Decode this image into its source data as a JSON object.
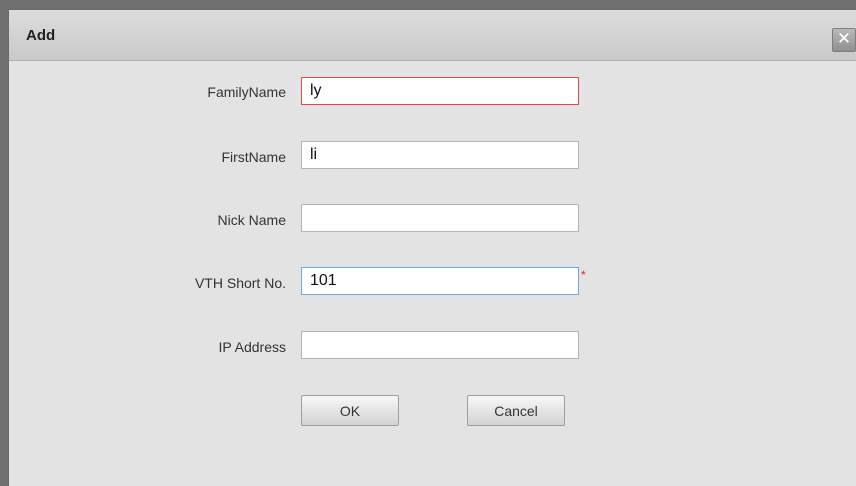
{
  "dialog": {
    "title": "Add",
    "close_glyph": "✕",
    "close_icon": "close-icon"
  },
  "form": {
    "family_name": {
      "label": "FamilyName",
      "value": "ly"
    },
    "first_name": {
      "label": "FirstName",
      "value": "li"
    },
    "nick_name": {
      "label": "Nick Name",
      "value": ""
    },
    "vth_short_no": {
      "label": "VTH Short No.",
      "value": "101",
      "required_mark": "*"
    },
    "ip_address": {
      "label": "IP Address",
      "value": ""
    }
  },
  "buttons": {
    "ok": "OK",
    "cancel": "Cancel"
  },
  "colors": {
    "error_border": "#e24a3b",
    "focus_border": "#6aa9e3",
    "required": "#e0281c"
  }
}
